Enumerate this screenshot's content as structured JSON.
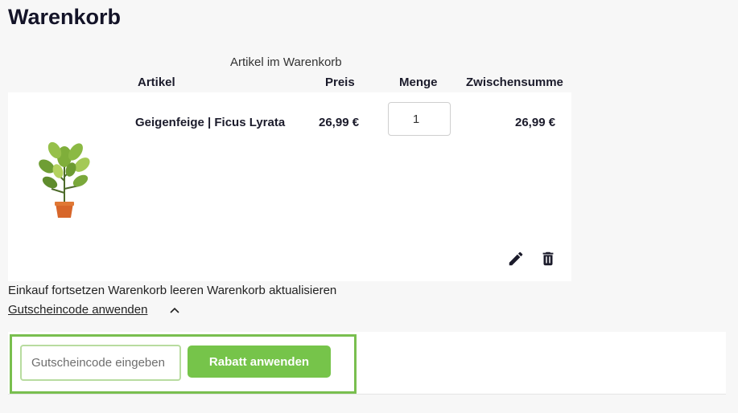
{
  "page": {
    "title": "Warenkorb"
  },
  "cart": {
    "caption": "Artikel im Warenkorb",
    "headers": {
      "artikel": "Artikel",
      "preis": "Preis",
      "menge": "Menge",
      "zwischensumme": "Zwischensumme"
    },
    "items": [
      {
        "name": "Geigenfeige | Ficus Lyrata",
        "price": "26,99 €",
        "quantity": "1",
        "subtotal": "26,99 €",
        "image_icon": "plant-image",
        "edit_icon": "pencil-icon",
        "delete_icon": "trash-icon"
      }
    ],
    "actions": {
      "continue": "Einkauf fortsetzen",
      "clear": "Warenkorb leeren",
      "update": "Warenkorb aktualisieren"
    }
  },
  "coupon": {
    "toggle_label": "Gutscheincode anwenden",
    "toggle_icon": "chevron-up-icon",
    "input_value": "",
    "input_placeholder": "Gutscheincode eingeben",
    "button_label": "Rabatt anwenden"
  },
  "colors": {
    "accent": "#76c44a",
    "highlight": "#79bf4f",
    "text": "#1b1b2b"
  }
}
